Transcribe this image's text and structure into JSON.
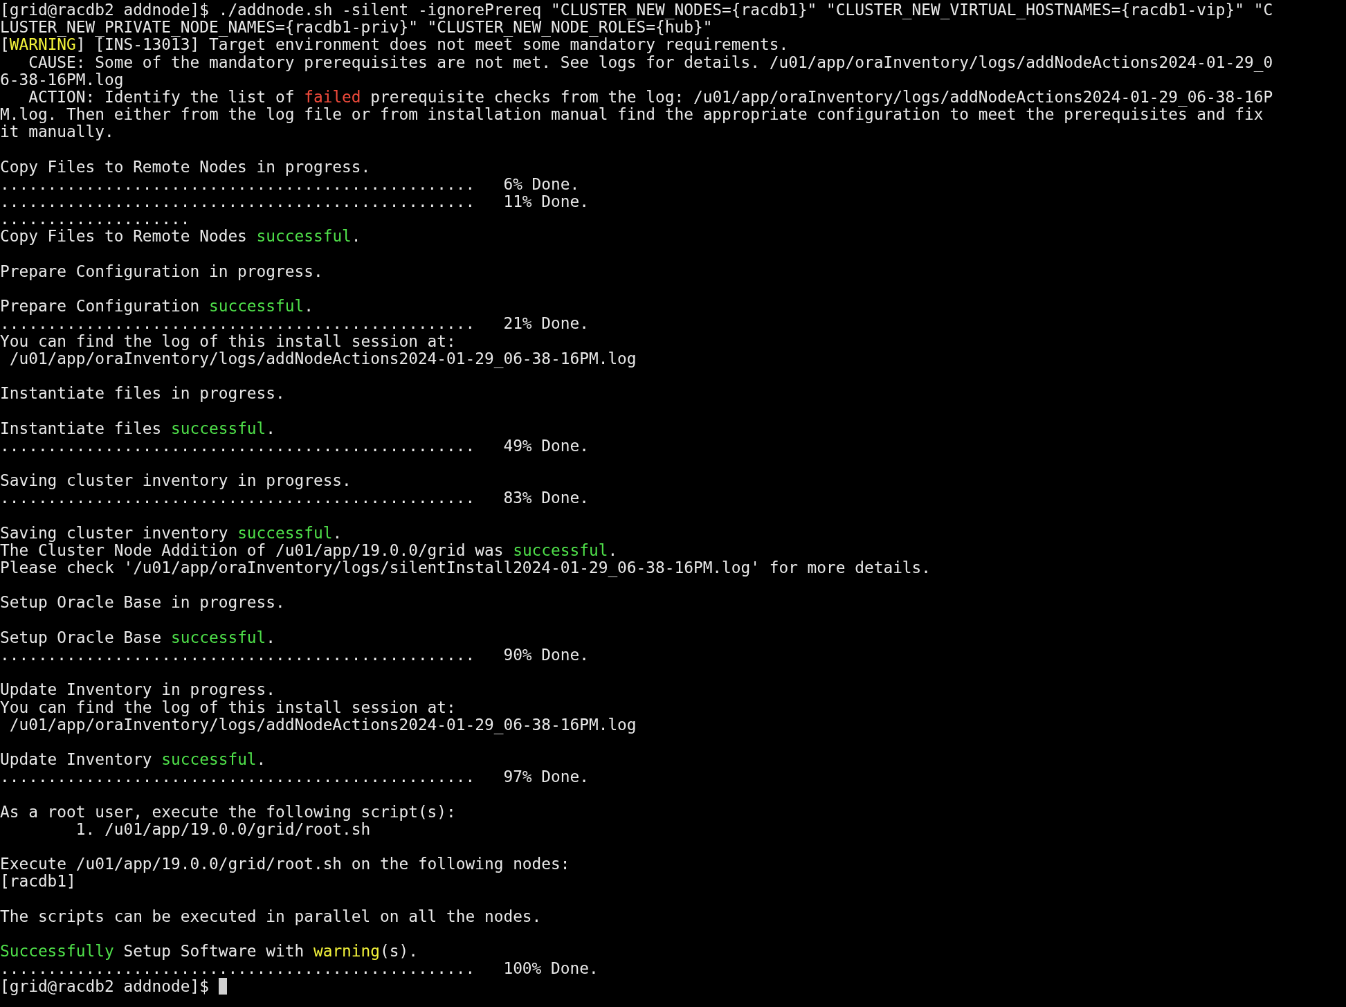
{
  "terminal": {
    "lines": [
      {
        "kind": "text",
        "spans": [
          {
            "text": "[grid@racdb2 addnode]$ ./addnode.sh -silent -ignorePrereq \"CLUSTER_NEW_NODES={racdb1}\" \"CLUSTER_NEW_VIRTUAL_HOSTNAMES={racdb1-vip}\" \"C",
            "kind": "plain"
          }
        ]
      },
      {
        "kind": "text",
        "spans": [
          {
            "text": "LUSTER_NEW_PRIVATE_NODE_NAMES={racdb1-priv}\" \"CLUSTER_NEW_NODE_ROLES={hub}\"",
            "kind": "plain"
          }
        ]
      },
      {
        "kind": "text",
        "spans": [
          {
            "text": "[",
            "kind": "plain"
          },
          {
            "text": "WARNING",
            "kind": "warning"
          },
          {
            "text": "] [INS-13013] Target environment does not meet some mandatory requirements.",
            "kind": "plain"
          }
        ]
      },
      {
        "kind": "text",
        "spans": [
          {
            "text": "   CAUSE: Some of the mandatory prerequisites are not met. See logs for details. /u01/app/oraInventory/logs/addNodeActions2024-01-29_0",
            "kind": "plain"
          }
        ]
      },
      {
        "kind": "text",
        "spans": [
          {
            "text": "6-38-16PM.log",
            "kind": "plain"
          }
        ]
      },
      {
        "kind": "text",
        "spans": [
          {
            "text": "   ACTION: Identify the list of ",
            "kind": "plain"
          },
          {
            "text": "failed",
            "kind": "error"
          },
          {
            "text": " prerequisite checks from the log: /u01/app/oraInventory/logs/addNodeActions2024-01-29_06-38-16P",
            "kind": "plain"
          }
        ]
      },
      {
        "kind": "text",
        "spans": [
          {
            "text": "M.log. Then either from the log file or from installation manual find the appropriate configuration to meet the prerequisites and fix",
            "kind": "plain"
          }
        ]
      },
      {
        "kind": "text",
        "spans": [
          {
            "text": "it manually.",
            "kind": "plain"
          }
        ]
      },
      {
        "kind": "blank"
      },
      {
        "kind": "text",
        "spans": [
          {
            "text": "Copy Files to Remote Nodes in progress.",
            "kind": "plain"
          }
        ]
      },
      {
        "kind": "text",
        "spans": [
          {
            "text": "..................................................   6% Done.",
            "kind": "plain"
          }
        ]
      },
      {
        "kind": "text",
        "spans": [
          {
            "text": "..................................................   11% Done.",
            "kind": "plain"
          }
        ]
      },
      {
        "kind": "text",
        "spans": [
          {
            "text": "....................",
            "kind": "plain"
          }
        ]
      },
      {
        "kind": "text",
        "spans": [
          {
            "text": "Copy Files to Remote Nodes ",
            "kind": "plain"
          },
          {
            "text": "successful",
            "kind": "success"
          },
          {
            "text": ".",
            "kind": "plain"
          }
        ]
      },
      {
        "kind": "blank"
      },
      {
        "kind": "text",
        "spans": [
          {
            "text": "Prepare Configuration in progress.",
            "kind": "plain"
          }
        ]
      },
      {
        "kind": "blank"
      },
      {
        "kind": "text",
        "spans": [
          {
            "text": "Prepare Configuration ",
            "kind": "plain"
          },
          {
            "text": "successful",
            "kind": "success"
          },
          {
            "text": ".",
            "kind": "plain"
          }
        ]
      },
      {
        "kind": "text",
        "spans": [
          {
            "text": "..................................................   21% Done.",
            "kind": "plain"
          }
        ]
      },
      {
        "kind": "text",
        "spans": [
          {
            "text": "You can find the log of this install session at:",
            "kind": "plain"
          }
        ]
      },
      {
        "kind": "text",
        "spans": [
          {
            "text": " /u01/app/oraInventory/logs/addNodeActions2024-01-29_06-38-16PM.log",
            "kind": "plain"
          }
        ]
      },
      {
        "kind": "blank"
      },
      {
        "kind": "text",
        "spans": [
          {
            "text": "Instantiate files in progress.",
            "kind": "plain"
          }
        ]
      },
      {
        "kind": "blank"
      },
      {
        "kind": "text",
        "spans": [
          {
            "text": "Instantiate files ",
            "kind": "plain"
          },
          {
            "text": "successful",
            "kind": "success"
          },
          {
            "text": ".",
            "kind": "plain"
          }
        ]
      },
      {
        "kind": "text",
        "spans": [
          {
            "text": "..................................................   49% Done.",
            "kind": "plain"
          }
        ]
      },
      {
        "kind": "blank"
      },
      {
        "kind": "text",
        "spans": [
          {
            "text": "Saving cluster inventory in progress.",
            "kind": "plain"
          }
        ]
      },
      {
        "kind": "text",
        "spans": [
          {
            "text": "..................................................   83% Done.",
            "kind": "plain"
          }
        ]
      },
      {
        "kind": "blank"
      },
      {
        "kind": "text",
        "spans": [
          {
            "text": "Saving cluster inventory ",
            "kind": "plain"
          },
          {
            "text": "successful",
            "kind": "success"
          },
          {
            "text": ".",
            "kind": "plain"
          }
        ]
      },
      {
        "kind": "text",
        "spans": [
          {
            "text": "The Cluster Node Addition of /u01/app/19.0.0/grid was ",
            "kind": "plain"
          },
          {
            "text": "successful",
            "kind": "success"
          },
          {
            "text": ".",
            "kind": "plain"
          }
        ]
      },
      {
        "kind": "text",
        "spans": [
          {
            "text": "Please check '/u01/app/oraInventory/logs/silentInstall2024-01-29_06-38-16PM.log' for more details.",
            "kind": "plain"
          }
        ]
      },
      {
        "kind": "blank"
      },
      {
        "kind": "text",
        "spans": [
          {
            "text": "Setup Oracle Base in progress.",
            "kind": "plain"
          }
        ]
      },
      {
        "kind": "blank"
      },
      {
        "kind": "text",
        "spans": [
          {
            "text": "Setup Oracle Base ",
            "kind": "plain"
          },
          {
            "text": "successful",
            "kind": "success"
          },
          {
            "text": ".",
            "kind": "plain"
          }
        ]
      },
      {
        "kind": "text",
        "spans": [
          {
            "text": "..................................................   90% Done.",
            "kind": "plain"
          }
        ]
      },
      {
        "kind": "blank"
      },
      {
        "kind": "text",
        "spans": [
          {
            "text": "Update Inventory in progress.",
            "kind": "plain"
          }
        ]
      },
      {
        "kind": "text",
        "spans": [
          {
            "text": "You can find the log of this install session at:",
            "kind": "plain"
          }
        ]
      },
      {
        "kind": "text",
        "spans": [
          {
            "text": " /u01/app/oraInventory/logs/addNodeActions2024-01-29_06-38-16PM.log",
            "kind": "plain"
          }
        ]
      },
      {
        "kind": "blank"
      },
      {
        "kind": "text",
        "spans": [
          {
            "text": "Update Inventory ",
            "kind": "plain"
          },
          {
            "text": "successful",
            "kind": "success"
          },
          {
            "text": ".",
            "kind": "plain"
          }
        ]
      },
      {
        "kind": "text",
        "spans": [
          {
            "text": "..................................................   97% Done.",
            "kind": "plain"
          }
        ]
      },
      {
        "kind": "blank"
      },
      {
        "kind": "text",
        "spans": [
          {
            "text": "As a root user, execute the following script(s):",
            "kind": "plain"
          }
        ]
      },
      {
        "kind": "text",
        "spans": [
          {
            "text": "        1. /u01/app/19.0.0/grid/root.sh",
            "kind": "plain"
          }
        ]
      },
      {
        "kind": "blank"
      },
      {
        "kind": "text",
        "spans": [
          {
            "text": "Execute /u01/app/19.0.0/grid/root.sh on the following nodes:",
            "kind": "plain"
          }
        ]
      },
      {
        "kind": "text",
        "spans": [
          {
            "text": "[racdb1]",
            "kind": "plain"
          }
        ]
      },
      {
        "kind": "blank"
      },
      {
        "kind": "text",
        "spans": [
          {
            "text": "The scripts can be executed in parallel on all the nodes.",
            "kind": "plain"
          }
        ]
      },
      {
        "kind": "blank"
      },
      {
        "kind": "text",
        "spans": [
          {
            "text": "Successfully",
            "kind": "success"
          },
          {
            "text": " Setup Software with ",
            "kind": "plain"
          },
          {
            "text": "warning",
            "kind": "warning"
          },
          {
            "text": "(s).",
            "kind": "plain"
          }
        ]
      },
      {
        "kind": "text",
        "spans": [
          {
            "text": "..................................................   100% Done.",
            "kind": "plain"
          }
        ]
      },
      {
        "kind": "text",
        "cursor": true,
        "spans": [
          {
            "text": "[grid@racdb2 addnode]$ ",
            "kind": "plain"
          }
        ]
      }
    ]
  }
}
